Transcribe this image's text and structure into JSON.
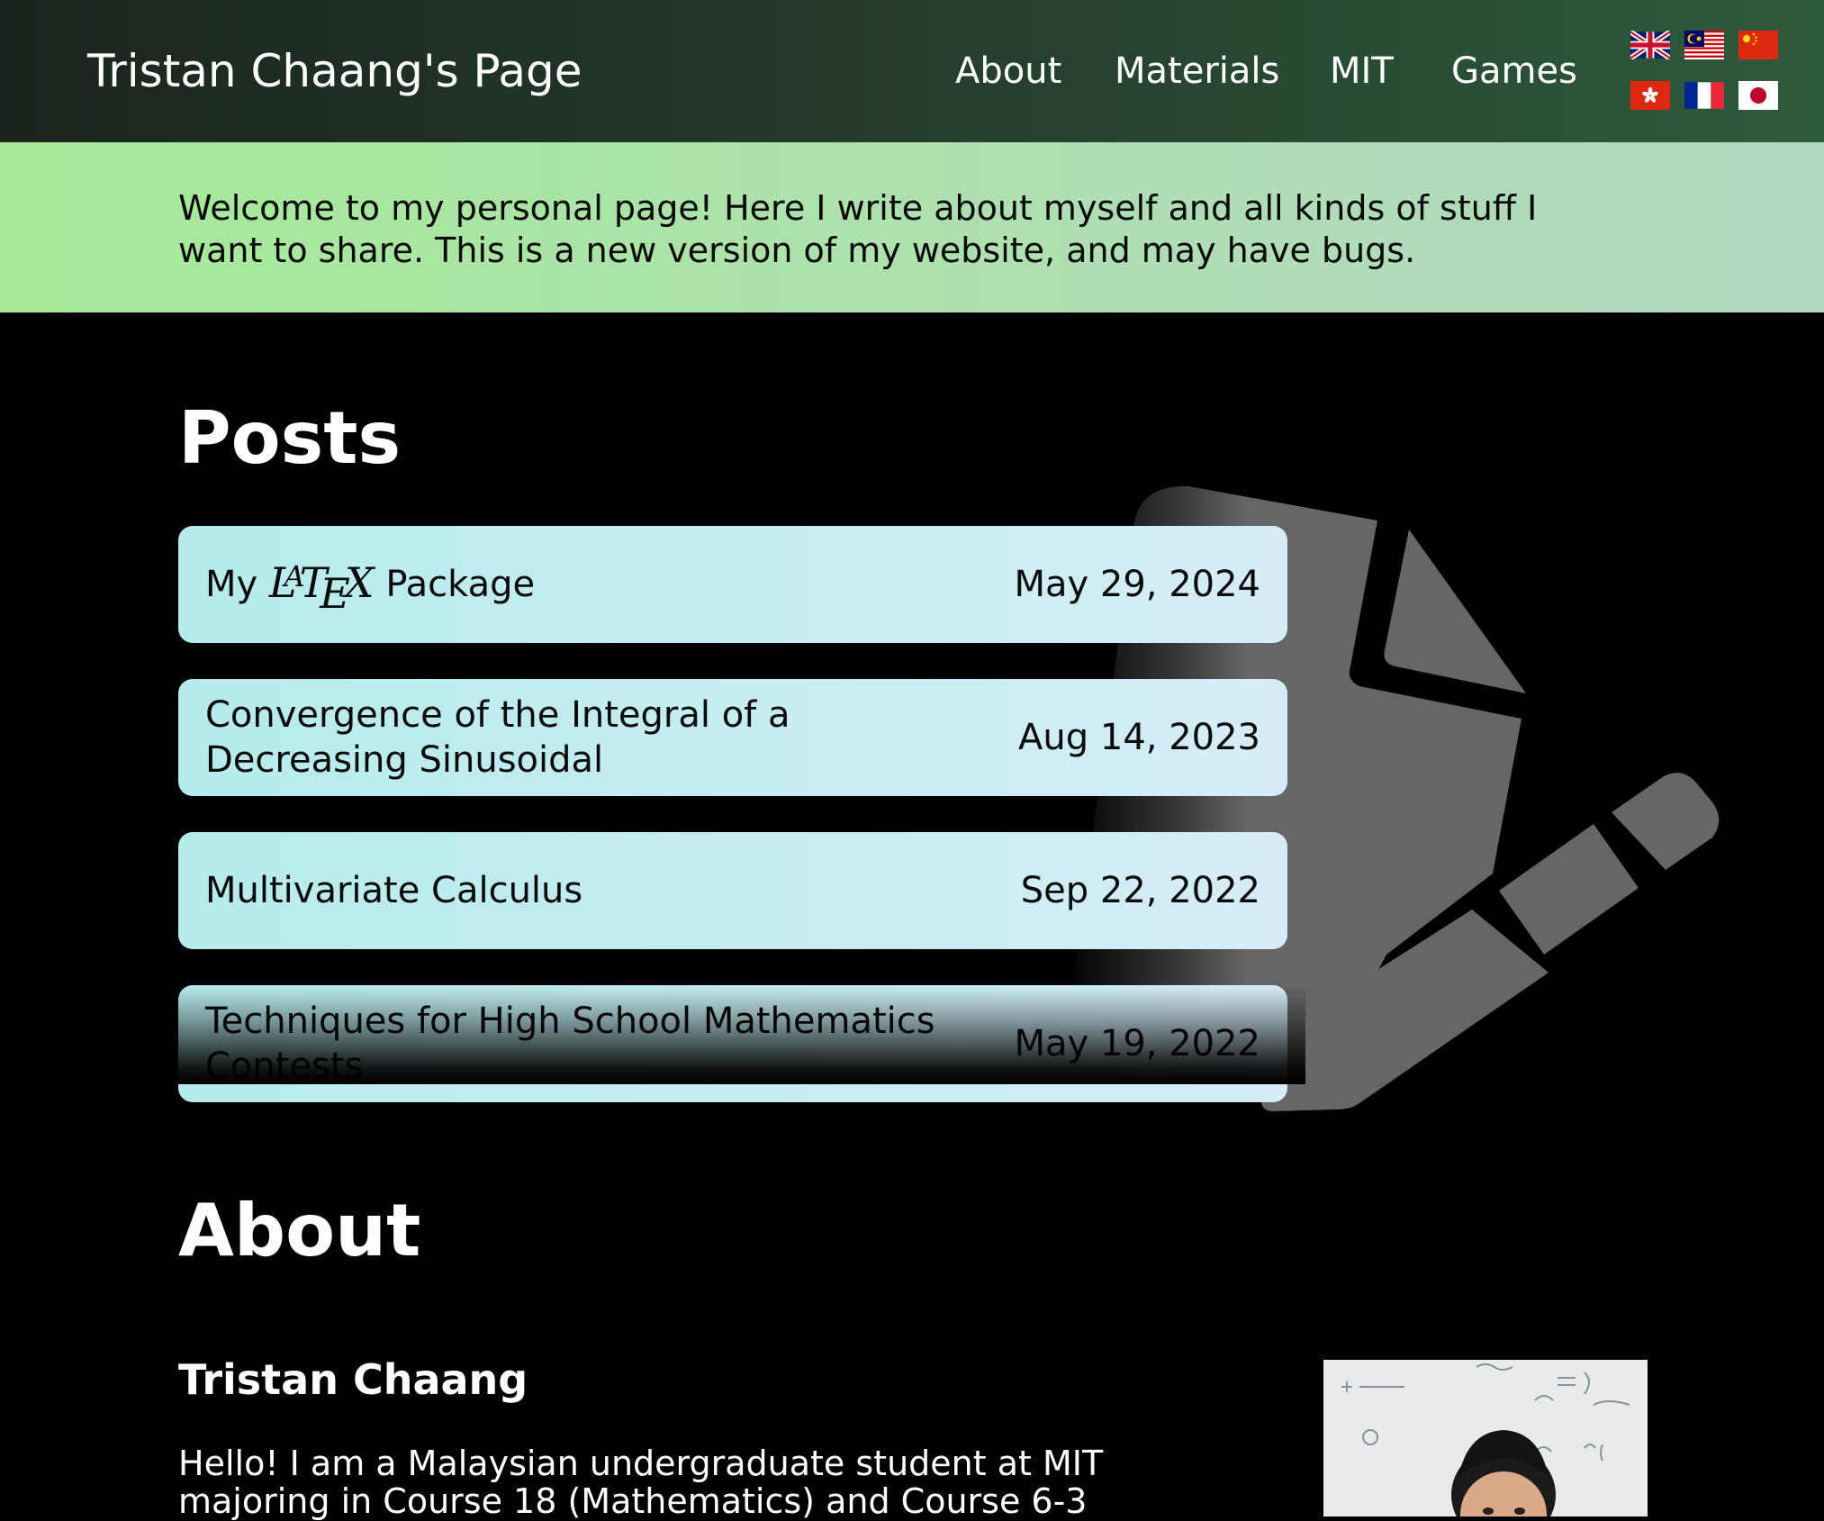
{
  "header": {
    "site_title": "Tristan Chaang's Page",
    "nav": [
      "About",
      "Materials",
      "MIT",
      "Games"
    ],
    "flags": [
      "uk-flag-icon",
      "malaysia-flag-icon",
      "china-flag-icon",
      "hong-kong-flag-icon",
      "france-flag-icon",
      "japan-flag-icon"
    ]
  },
  "banner": {
    "text": "Welcome to my personal page! Here I write about myself and all kinds of stuff I want to share. This is a new version of my website, and may have bugs."
  },
  "posts": {
    "heading": "Posts",
    "items": [
      {
        "title_prefix": "My",
        "title_logo": "LaTeX",
        "title_suffix": "Package",
        "date": "May 29, 2024"
      },
      {
        "title": "Convergence of the Integral of a Decreasing Sinusoidal",
        "date": "Aug 14, 2023"
      },
      {
        "title": "Multivariate Calculus",
        "date": "Sep 22, 2022"
      },
      {
        "title": "Techniques for High School Mathematics Contests",
        "date": "May 19, 2022"
      }
    ]
  },
  "about": {
    "heading": "About",
    "name": "Tristan Chaang",
    "intro": "Hello! I am a Malaysian undergraduate student at MIT majoring in Course 18 (Mathematics) and Course 6-3"
  },
  "colors": {
    "header_start": "#1b241e",
    "header_end": "#2e5a3c",
    "banner_start": "#a6ea98",
    "banner_end": "#b2d7c3",
    "card_start": "#b6ebed",
    "card_end": "#d6edf9",
    "icon_gray": "#666666"
  }
}
